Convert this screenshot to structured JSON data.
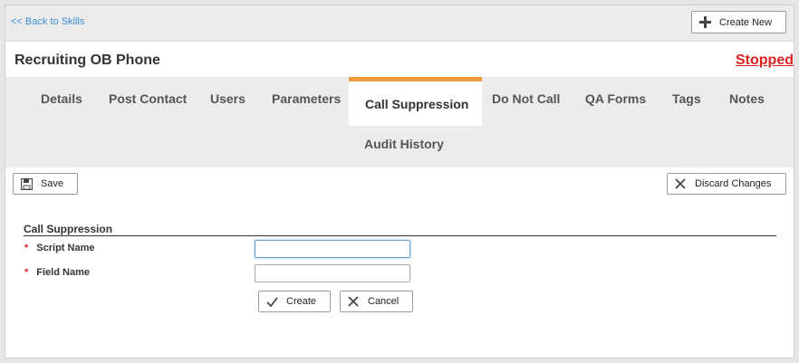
{
  "topbar": {
    "back_label": "<< Back to Skills",
    "create_new_label": "Create New"
  },
  "title": {
    "text": "Recruiting OB Phone",
    "status": "Stopped",
    "status_color": "#e02020"
  },
  "tabs": [
    {
      "label": "Details"
    },
    {
      "label": "Post Contact"
    },
    {
      "label": "Users"
    },
    {
      "label": "Parameters"
    },
    {
      "label": "Call Suppression",
      "active": true
    },
    {
      "label": "Do Not Call"
    },
    {
      "label": "QA Forms"
    },
    {
      "label": "Tags"
    },
    {
      "label": "Notes"
    },
    {
      "label": "Audit History"
    }
  ],
  "toolbar": {
    "save_label": "Save",
    "discard_label": "Discard Changes"
  },
  "form": {
    "section_title": "Call Suppression",
    "fields": [
      {
        "label": "Script Name",
        "required_mark": "*",
        "value": ""
      },
      {
        "label": "Field Name",
        "required_mark": "*",
        "value": ""
      }
    ],
    "create_label": "Create",
    "cancel_label": "Cancel"
  },
  "colors": {
    "accent": "#f39a3d",
    "link": "#3a8fd6"
  }
}
